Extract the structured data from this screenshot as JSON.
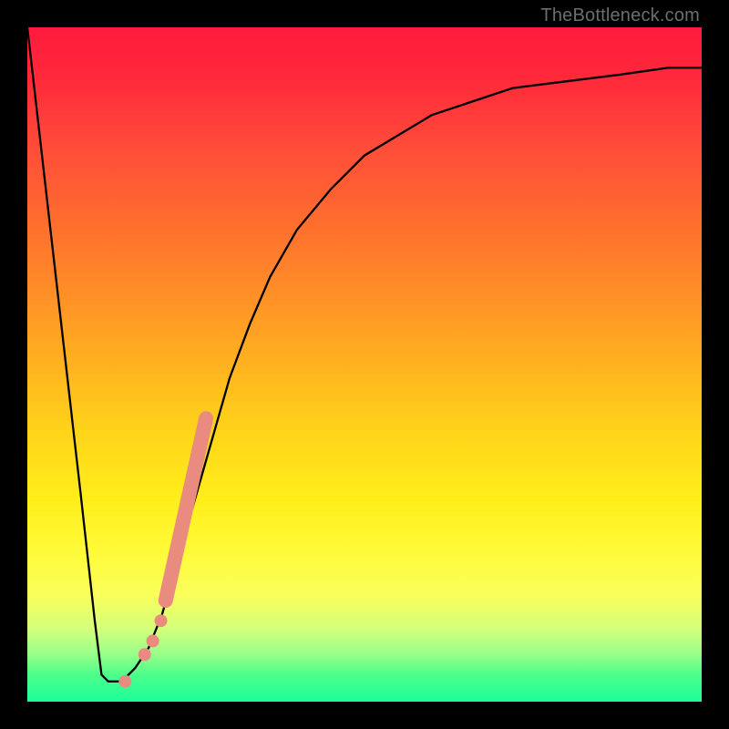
{
  "watermark": "TheBottleneck.com",
  "chart_data": {
    "type": "line",
    "title": "",
    "xlabel": "",
    "ylabel": "",
    "xlim": [
      0,
      100
    ],
    "ylim": [
      0,
      100
    ],
    "grid": false,
    "background": "rainbow-gradient-vertical red-top green-bottom",
    "series": [
      {
        "name": "bottleneck-curve",
        "color": "#000000",
        "x": [
          0,
          4,
          8,
          10,
          11,
          12,
          13,
          14,
          16,
          18,
          20,
          22,
          24,
          26,
          28,
          30,
          33,
          36,
          40,
          45,
          50,
          55,
          60,
          66,
          72,
          80,
          88,
          95,
          100
        ],
        "y": [
          100,
          65,
          30,
          12,
          4,
          3,
          3,
          3,
          5,
          8,
          13,
          20,
          27,
          34,
          41,
          48,
          56,
          63,
          70,
          76,
          81,
          84,
          87,
          89,
          91,
          92,
          93,
          94,
          94
        ]
      }
    ],
    "highlight_segment": {
      "name": "highlighted-range",
      "color": "#e98b7e",
      "x": [
        20.5,
        26.5
      ],
      "y": [
        15,
        42
      ]
    },
    "highlight_points": {
      "name": "highlighted-dots",
      "color": "#e98b7e",
      "points": [
        {
          "x": 19.8,
          "y": 12
        },
        {
          "x": 18.6,
          "y": 9
        },
        {
          "x": 17.4,
          "y": 7
        },
        {
          "x": 14.5,
          "y": 3
        }
      ]
    }
  }
}
